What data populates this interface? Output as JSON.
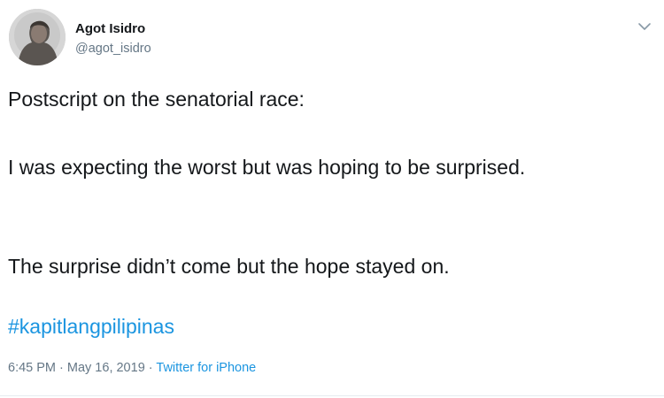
{
  "user": {
    "name": "Agot Isidro",
    "handle": "@agot_isidro"
  },
  "tweet": {
    "line1": "Postscript on the senatorial race:",
    "line2": "I was expecting the worst but was hoping to be surprised.",
    "line3": "The surprise didn’t come but the hope stayed on.",
    "hashtag": "#kapitlangpilipinas"
  },
  "meta": {
    "time": "6:45 PM",
    "date": "May 16, 2019",
    "separator": " · ",
    "source": "Twitter for iPhone"
  },
  "icons": {
    "caret": "chevron-down-icon"
  },
  "colors": {
    "link": "#1b95e0",
    "secondary_text": "#657786",
    "primary_text": "#14171a"
  }
}
